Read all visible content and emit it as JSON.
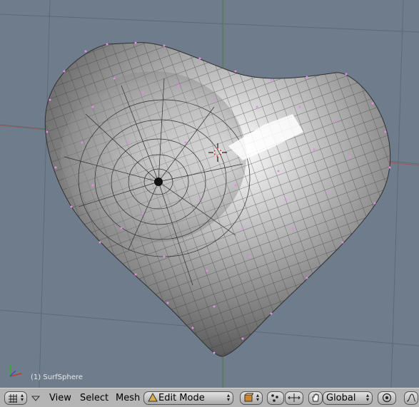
{
  "viewport": {
    "object_label": "(1) SurfSphere",
    "background_color": "#6f7c8b",
    "mesh_color": "#9a9a9a",
    "vertex_color": "#e58ce8"
  },
  "header": {
    "view_type_icon": "grid-icon",
    "menu_toggle_icon": "triangle-down-icon",
    "menus": [
      "View",
      "Select",
      "Mesh"
    ],
    "mode": {
      "icon": "mesh-mode-icon",
      "value": "Edit Mode"
    },
    "draw_type_icon": "cube-shading-icon",
    "pivot_icon": "pivot-icon",
    "transform_icon": "hand-manipulator-icon",
    "orientation": "Global",
    "proportional_icon": "proportional-icon"
  }
}
